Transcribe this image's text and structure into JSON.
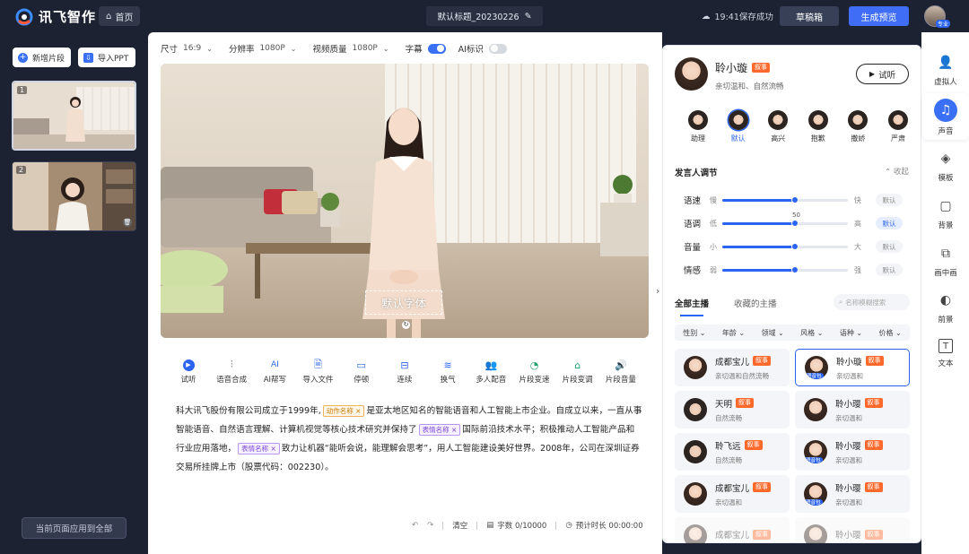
{
  "brand": {
    "name": "讯飞智作"
  },
  "header": {
    "home": "首页",
    "doc_title": "默认标题_20230226",
    "save_status": "19:41保存成功",
    "draft_box": "草稿箱",
    "generate": "生成预览",
    "user_badge": "专业"
  },
  "left": {
    "add_clip": "新增片段",
    "import_ppt": "导入PPT",
    "clips": [
      {
        "index": "1"
      },
      {
        "index": "2"
      }
    ],
    "apply_all": "当前页面应用到全部"
  },
  "settings": {
    "size_label": "尺寸",
    "size_value": "16:9",
    "resolution_label": "分辨率",
    "resolution_value": "1080P",
    "quality_label": "视频质量",
    "quality_value": "1080P",
    "subtitle_label": "字幕",
    "subtitle_on": true,
    "ai_mark_label": "AI标识",
    "ai_mark_on": false
  },
  "canvas": {
    "subtitle_text": "默认字体"
  },
  "toolbar": [
    {
      "label": "试听",
      "icon": "play-icon"
    },
    {
      "label": "语音合成",
      "icon": "waveform-icon"
    },
    {
      "label": "AI帮写",
      "icon": "ai-write-icon"
    },
    {
      "label": "导入文件",
      "icon": "import-file-icon"
    },
    {
      "label": "停顿",
      "icon": "pause-icon"
    },
    {
      "label": "连续",
      "icon": "continuous-icon"
    },
    {
      "label": "换气",
      "icon": "breath-icon"
    },
    {
      "label": "多人配音",
      "icon": "multi-voice-icon"
    },
    {
      "label": "片段变速",
      "icon": "speed-icon"
    },
    {
      "label": "片段变调",
      "icon": "pitch-icon"
    },
    {
      "label": "片段音量",
      "icon": "volume-icon"
    }
  ],
  "script": {
    "p1": "科大讯飞股份有限公司成立于1999年,",
    "tag1": "动作名称",
    "p2": "是亚太地区知名的智能语音和人工智能上市企业。自成立以来，一直从事智能语音、自然语言理解、计算机视觉等核心技术研究并保持了",
    "tag2": "表情名称",
    "p3": "国际前沿技术水平；积极推动人工智能产品和行业应用落地，",
    "tag3": "表情名称",
    "p4": "致力让机器“能听会说，能理解会思考”，用人工智能建设美好世界。2008年，公司在深圳证券交易所挂牌上市（股票代码：002230）。"
  },
  "editor_footer": {
    "clear": "清空",
    "char_count": "字数 0/10000",
    "est_duration": "预计时长 00:00:00"
  },
  "voice": {
    "name": "聆小璇",
    "badge": "叙事",
    "desc": "亲切温和、自然流畅",
    "preview": "试听",
    "emotions": [
      "助理",
      "默认",
      "高兴",
      "抱歉",
      "撒娇",
      "严肃"
    ],
    "selected_emotion": "默认",
    "adjust_title": "发言人调节",
    "collapse": "收起",
    "sliders": [
      {
        "name": "语速",
        "low": "慢",
        "high": "快",
        "default": "默认",
        "value": 0.58,
        "active": false
      },
      {
        "name": "语调",
        "low": "低",
        "high": "高",
        "default": "默认",
        "value": 0.58,
        "active": true,
        "readout": "50"
      },
      {
        "name": "音量",
        "low": "小",
        "high": "大",
        "default": "默认",
        "value": 0.58,
        "active": false
      },
      {
        "name": "情感",
        "low": "弱",
        "high": "强",
        "default": "默认",
        "value": 0.58,
        "active": false
      }
    ],
    "tabs": [
      "全部主播",
      "收藏的主播"
    ],
    "search_placeholder": "名称模糊搜索",
    "filters": [
      "性别",
      "年龄",
      "领域",
      "风格",
      "语种",
      "价格"
    ],
    "anchors": [
      {
        "name": "成都宝儿",
        "badge": "叙事",
        "desc": "亲切温和自然流畅",
        "gender": "female",
        "selected": false
      },
      {
        "name": "聆小璇",
        "badge": "叙事",
        "desc": "亲切温和",
        "gender": "female",
        "selected": true,
        "tag": "语音包"
      },
      {
        "name": "天明",
        "badge": "叙事",
        "desc": "自然流畅",
        "gender": "male",
        "selected": false
      },
      {
        "name": "聆小璎",
        "badge": "叙事",
        "desc": "亲切温和",
        "gender": "female",
        "selected": false
      },
      {
        "name": "聆飞远",
        "badge": "叙事",
        "desc": "自然流畅",
        "gender": "male",
        "selected": false
      },
      {
        "name": "聆小璎",
        "badge": "叙事",
        "desc": "亲切温和",
        "gender": "female",
        "selected": false,
        "tag": "语音包"
      },
      {
        "name": "成都宝儿",
        "badge": "叙事",
        "desc": "亲切温和",
        "gender": "female",
        "selected": false
      },
      {
        "name": "聆小璎",
        "badge": "叙事",
        "desc": "亲切温和",
        "gender": "female",
        "selected": false,
        "tag": "语音包"
      },
      {
        "name": "成都宝儿",
        "badge": "叙事",
        "desc": "",
        "gender": "female",
        "selected": false
      },
      {
        "name": "聆小璎",
        "badge": "叙事",
        "desc": "",
        "gender": "female",
        "selected": false
      }
    ]
  },
  "right_nav": [
    {
      "label": "虚拟人",
      "icon": "person-icon"
    },
    {
      "label": "声音",
      "icon": "music-note-icon",
      "selected": true
    },
    {
      "label": "模板",
      "icon": "layers-icon"
    },
    {
      "label": "背景",
      "icon": "background-icon"
    },
    {
      "label": "画中画",
      "icon": "picture-in-picture-icon"
    },
    {
      "label": "前景",
      "icon": "foreground-icon"
    },
    {
      "label": "文本",
      "icon": "text-icon"
    }
  ]
}
